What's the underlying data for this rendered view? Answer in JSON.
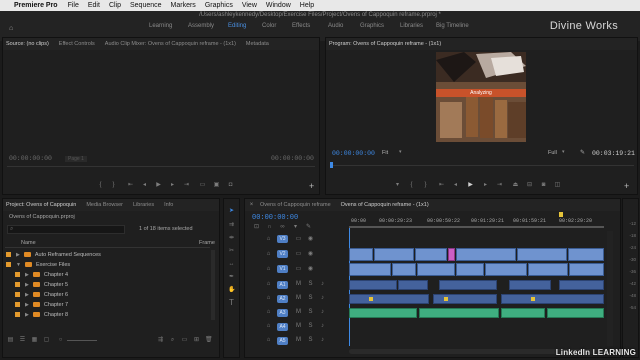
{
  "menubar": {
    "app": "Premiere Pro",
    "items": [
      "File",
      "Edit",
      "Clip",
      "Sequence",
      "Markers",
      "Graphics",
      "View",
      "Window",
      "Help"
    ]
  },
  "titlebar": {
    "path": "/Users/ashleykennedy/Desktop/Exercise Files/Project/Ovens of Cappoquin reframe.prproj *",
    "workspaces": [
      "Learning",
      "Assembly",
      "Editing",
      "Color",
      "Effects",
      "Audio",
      "Graphics",
      "Libraries",
      "Big Timeline"
    ],
    "active_workspace": "Editing",
    "brand": "Divine Works"
  },
  "source": {
    "tabs": [
      "Source: (no clips)",
      "Effect Controls",
      "Audio Clip Mixer: Ovens of Cappoquin reframe - (1x1)",
      "Metadata"
    ],
    "tc_left": "00:00:00:00",
    "tc_right": "00:00:00:00",
    "page": "Page 1"
  },
  "program": {
    "title": "Program: Ovens of Cappoquin reframe - (1x1)",
    "tc_left": "00:00:00:00",
    "fit": "Fit",
    "quality": "Full",
    "tc_right": "00:03:19:21",
    "overlay_text": "Analyzing"
  },
  "project": {
    "tabs": [
      "Project: Ovens of Cappoquin",
      "Media Browser",
      "Libraries",
      "Info"
    ],
    "file": "Ovens of Cappoquin.prproj",
    "selection_info": "1 of 18 items selected",
    "col_name": "Name",
    "col_frame": "Frame",
    "items": [
      {
        "label": "Auto Reframed Sequences",
        "indent": 0,
        "arrow": "▶"
      },
      {
        "label": "Exercise Files",
        "indent": 0,
        "arrow": "▼"
      },
      {
        "label": "Chapter 4",
        "indent": 1,
        "arrow": "▶"
      },
      {
        "label": "Chapter 5",
        "indent": 1,
        "arrow": "▶"
      },
      {
        "label": "Chapter 6",
        "indent": 1,
        "arrow": "▶"
      },
      {
        "label": "Chapter 7",
        "indent": 1,
        "arrow": "▶"
      },
      {
        "label": "Chapter 8",
        "indent": 1,
        "arrow": "▶"
      }
    ]
  },
  "timeline": {
    "tabs": [
      "Ovens of Cappoquin reframe",
      "Ovens of Cappoquin reframe - (1x1)"
    ],
    "active_tab": "Ovens of Cappoquin reframe - (1x1)",
    "timecode": "00:00:00:00",
    "ruler": [
      "00:00",
      "00:00:29:23",
      "00:00:59:22",
      "00:01:29:21",
      "00:01:59:21",
      "00:02:29:20"
    ],
    "tracks": [
      "V3",
      "V2",
      "V1",
      "A1",
      "A2",
      "A3",
      "A4",
      "A5"
    ]
  },
  "meters": [
    "-12",
    "-18",
    "-24",
    "-30",
    "-36",
    "-42",
    "-48",
    "-54"
  ],
  "watermark": "LinkedIn LEARNING",
  "colors": {
    "accent": "#3e8ae6",
    "folder": "#e08a24",
    "video_clip": "#6f93cf",
    "audio_clip": "#44629c",
    "music_clip": "#3fae80"
  }
}
